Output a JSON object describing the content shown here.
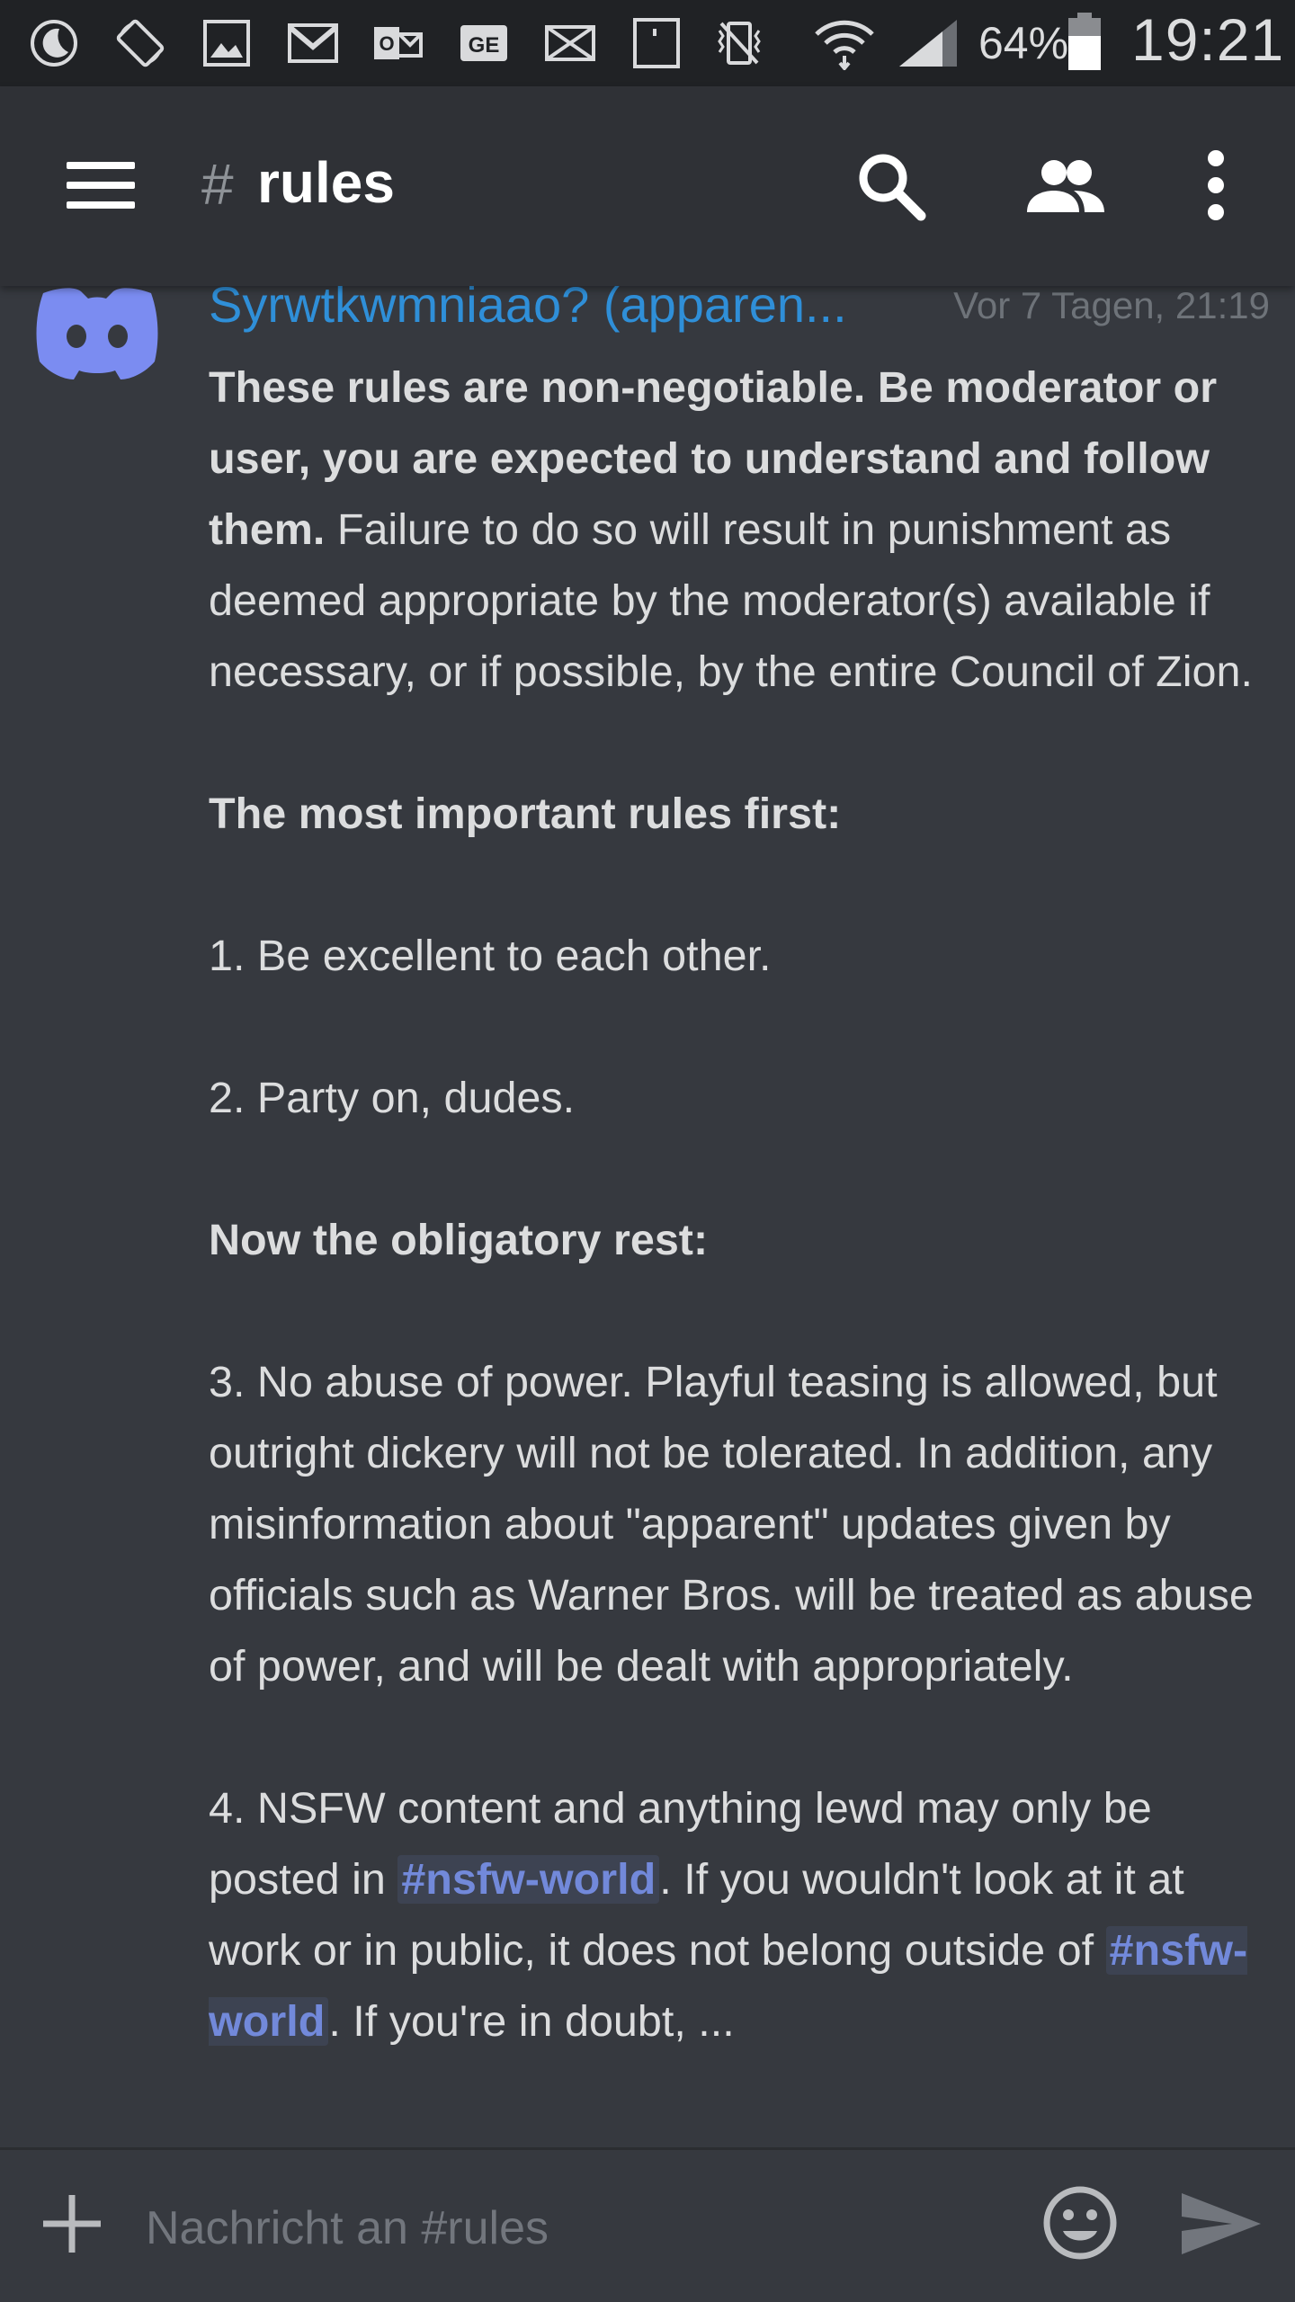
{
  "status_bar": {
    "battery_percent": "64%",
    "time": "19:21",
    "icons": [
      "moon-icon",
      "rotate-icon",
      "gallery-icon",
      "gmail-icon",
      "outlook-icon",
      "ge-icon",
      "mail-icon",
      "tablet-icon",
      "vibrate-icon",
      "wifi-icon",
      "signal-icon",
      "battery-icon"
    ]
  },
  "top_bar": {
    "hash": "#",
    "channel_name": "rules",
    "icons": [
      "menu-icon",
      "search-icon",
      "members-icon",
      "more-icon"
    ]
  },
  "message": {
    "username": "Syrwtkwmniaao? (apparen...",
    "timestamp": "Vor 7 Tagen, 21:19",
    "username_color": "#2f8fd8",
    "intro_bold": "These rules are non-negotiable. Be moderator or user, you are expected to understand and follow them.",
    "intro_rest": " Failure to do so will result in punishment as deemed appropriate by the moderator(s) available if necessary, or if possible, by the entire Council of Zion.",
    "important_heading": "The most important rules first:",
    "rule1": "1. Be excellent to each other.",
    "rule2": "2. Party on, dudes.",
    "rest_heading": "Now the obligatory rest:",
    "rule3": "3. No abuse of power. Playful teasing is allowed, but outright dickery will not be tolerated. In addition, any misinformation about \"apparent\" updates given by officials such as Warner Bros. will be treated as abuse of power, and will be dealt with appropriately.",
    "rule4_a": "4. NSFW content and anything lewd may only be posted in ",
    "rule4_mention": "#nsfw-world",
    "rule4_b": ". If you wouldn't look at it at work or in public, it does not belong outside of ",
    "rule4_mention2": "#nsfw-world",
    "rule4_c": ". If you're in doubt, ...",
    "mention_color": "#7289da"
  },
  "input_bar": {
    "placeholder": "Nachricht an #rules",
    "icons": [
      "plus-icon",
      "emoji-icon",
      "send-icon"
    ]
  }
}
